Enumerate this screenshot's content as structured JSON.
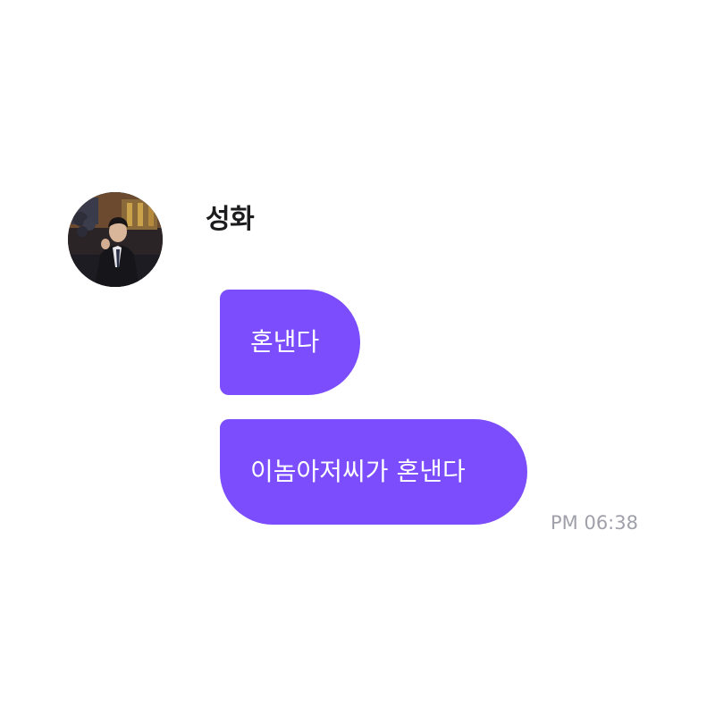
{
  "chat": {
    "sender": {
      "name": "성화",
      "avatar_icon": "profile-photo"
    },
    "messages": [
      {
        "text": "혼낸다"
      },
      {
        "text": "이놈아저씨가 혼낸다"
      }
    ],
    "timestamp": "PM 06:38"
  },
  "colors": {
    "bubble": "#7b4dfc",
    "bubble_text": "#ffffff",
    "timestamp": "#a0a0ab",
    "sender_name": "#1c1c1e",
    "background": "#ffffff"
  }
}
